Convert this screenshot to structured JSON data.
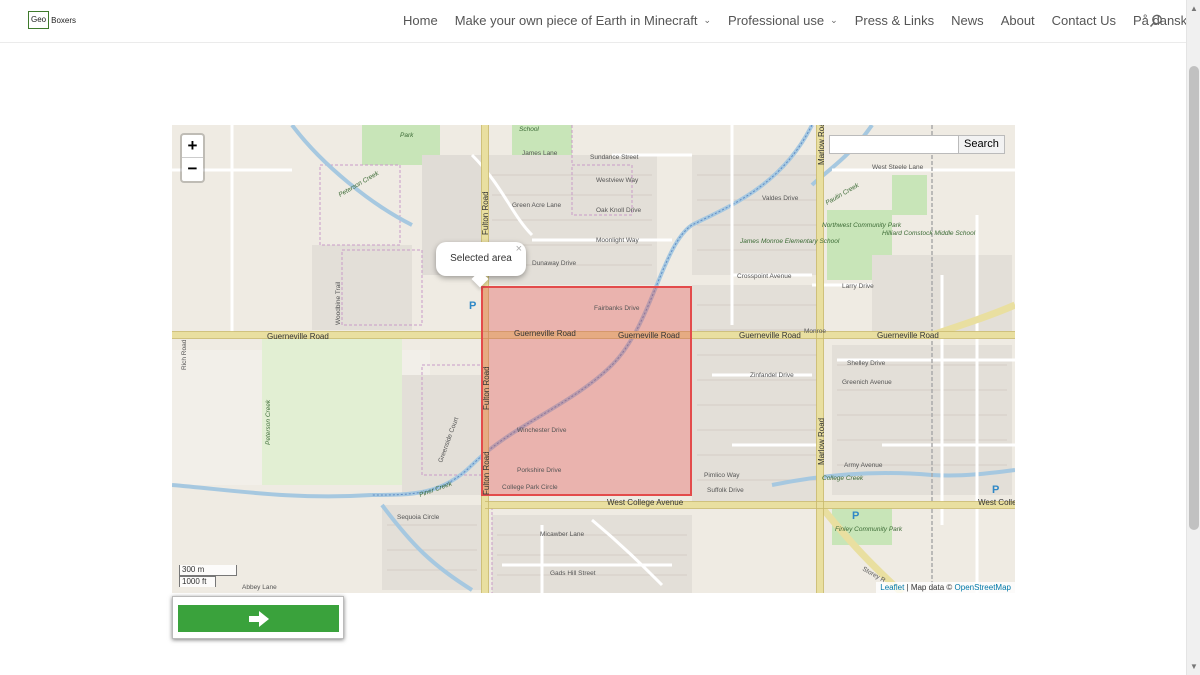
{
  "header": {
    "logo_box": "Geo",
    "logo_text": "Boxers",
    "nav": [
      {
        "label": "Home",
        "has_dropdown": false
      },
      {
        "label": "Make your own piece of Earth in Minecraft",
        "has_dropdown": true
      },
      {
        "label": "Professional use",
        "has_dropdown": true
      },
      {
        "label": "Press & Links",
        "has_dropdown": false
      },
      {
        "label": "News",
        "has_dropdown": false
      },
      {
        "label": "About",
        "has_dropdown": false
      },
      {
        "label": "Contact Us",
        "has_dropdown": false
      },
      {
        "label": "På dansk",
        "has_dropdown": false
      }
    ],
    "search_icon": "search-icon"
  },
  "map": {
    "zoom_in": "+",
    "zoom_out": "−",
    "search_placeholder": "",
    "search_button": "Search",
    "popup_text": "Selected area",
    "popup_close": "×",
    "scale_metric": "300 m",
    "scale_imperial": "1000 ft",
    "attribution_leaflet": "Leaflet",
    "attribution_sep": " | Map data © ",
    "attribution_osm": "OpenStreetMap",
    "selection_color": "#e34b4b",
    "street_labels": {
      "guerneville_left": "Guerneville Road",
      "guerneville_mid1": "Guerneville Road",
      "guerneville_mid2": "Guerneville Road",
      "guerneville_right1": "Guerneville Road",
      "guerneville_right2": "Guerneville Road",
      "fulton_top": "Fulton Road",
      "fulton_mid": "Fulton Road",
      "fulton_bottom": "Fulton Road",
      "marlow_top": "Marlow Road",
      "marlow_bottom": "Marlow Road",
      "west_college": "West College Avenue",
      "west_college_right": "West College",
      "west_steele": "West Steele Lane",
      "sundance": "Sundance Street",
      "westview": "Westview Way",
      "oak_knoll": "Oak Knoll Drive",
      "moonlight": "Moonlight Way",
      "green_acre": "Green Acre Lane",
      "james": "James Lane",
      "fairbanks": "Fairbanks Drive",
      "zinfandel": "Zinfandel Drive",
      "crosspoint": "Crosspoint Avenue",
      "larry": "Larry Drive",
      "shelley": "Shelley Drive",
      "greenich": "Greenich Avenue",
      "suffolk": "Suffolk Drive",
      "pimlico": "Pimlico Way",
      "army": "Army Avenue",
      "gads_hill": "Gads Hill Street",
      "micawber": "Micawber Lane",
      "sequoia": "Sequoia Circle",
      "rich": "Rich Road",
      "college_park": "College Park Circle",
      "porkshire": "Porkshire Drive",
      "winchester": "Winchester Drive",
      "woodbine": "Woodbine Trail",
      "abbey": "Abbey Lane",
      "valdes": "Valdes Drive",
      "monroe": "Monroe",
      "peterson1": "Peterson Creek",
      "peterson2": "Peterson Creek",
      "paulin": "Paulin Creek",
      "piner": "Piner Creek",
      "college_creek": "College Creek",
      "dunaway": "Dunaway Drive",
      "greenside": "Greenside Court",
      "storey": "Storey R"
    },
    "place_labels": {
      "park_top": "Park",
      "school_top": "School",
      "northwest_park": "Northwest Community Park",
      "james_monroe": "James Monroe Elementary School",
      "hilliard": "Hilliard Comstock Middle School",
      "finley": "Finley Community Park"
    }
  },
  "next_button_icon": "arrow-right-icon"
}
